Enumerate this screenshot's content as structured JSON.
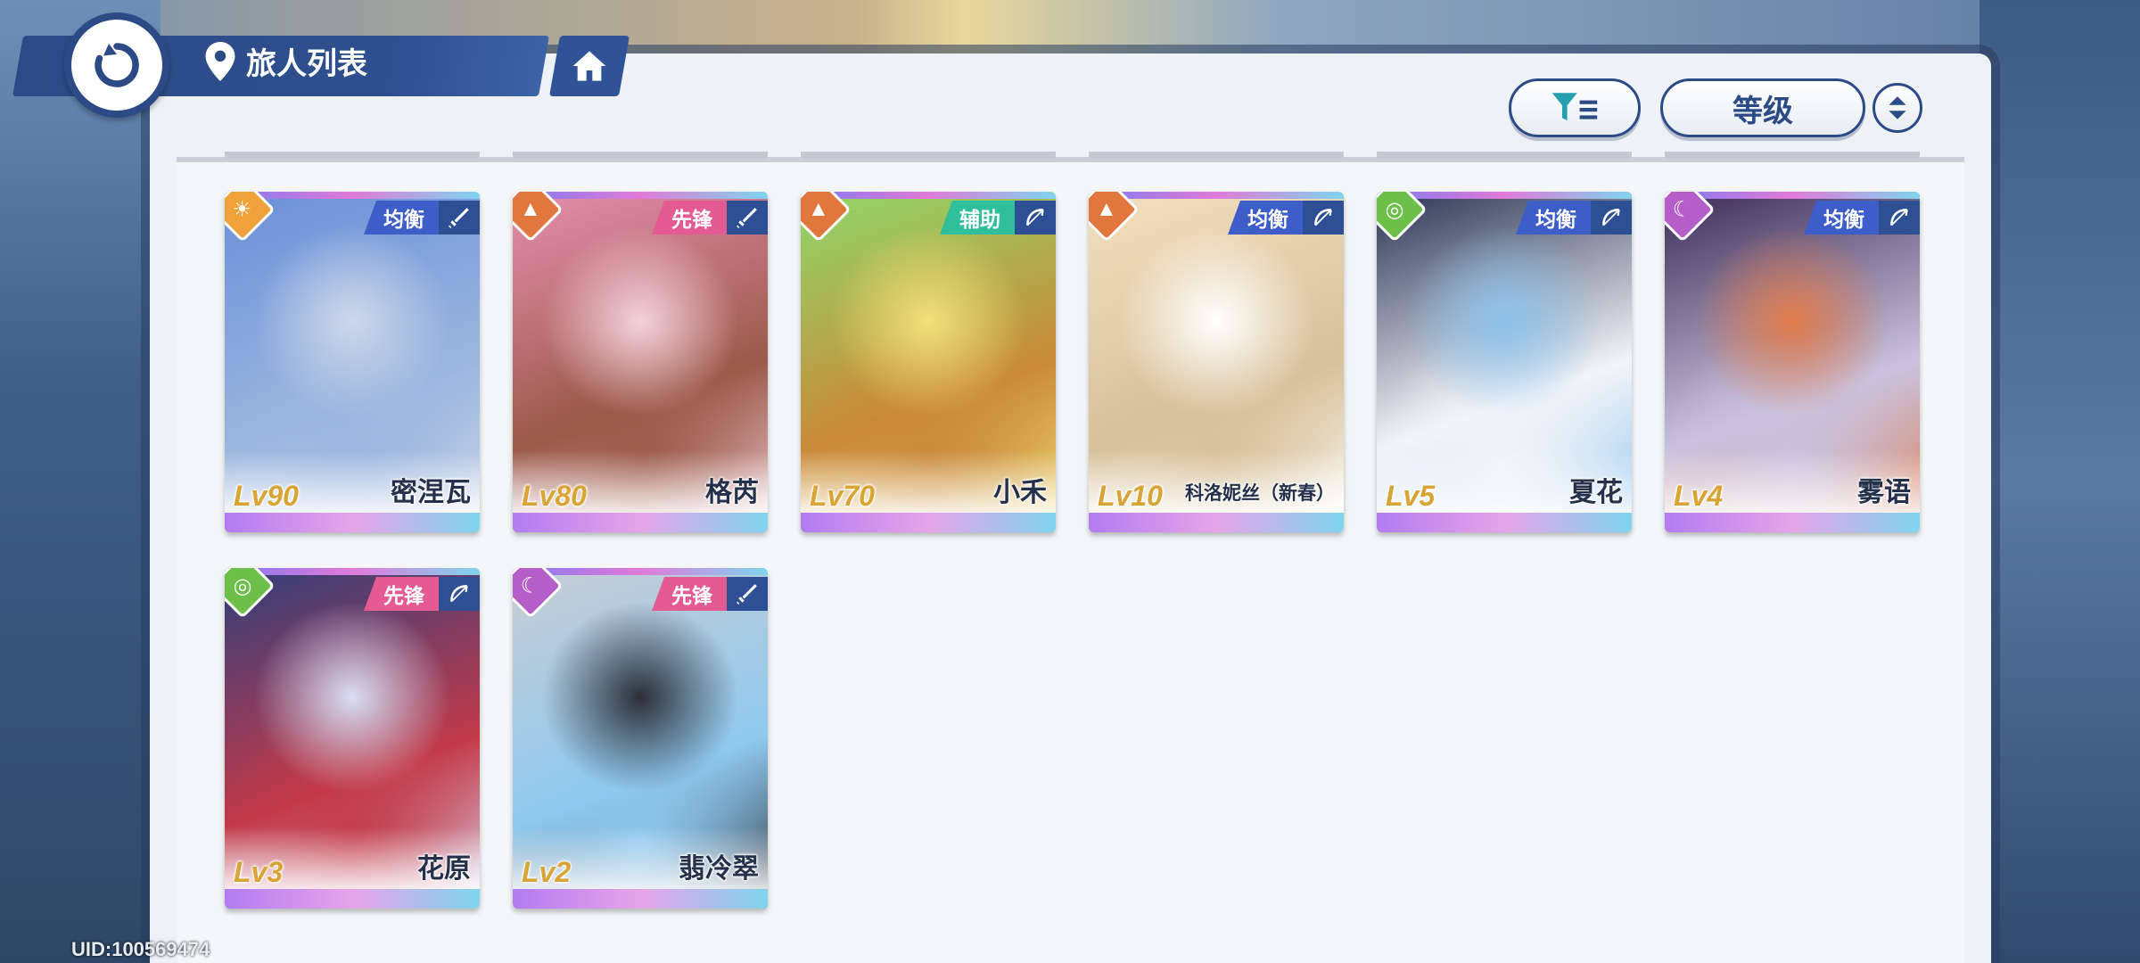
{
  "header": {
    "title": "旅人列表"
  },
  "toolbar": {
    "sort_label": "等级"
  },
  "colors": {
    "primary_dark_blue": "#2c4a86",
    "tag_pink": "#e45b93",
    "tag_blue": "#3d5ec8",
    "tag_green": "#2fbf9a",
    "level_gold": "#d8a535"
  },
  "cards": [
    {
      "level": "Lv90",
      "name": "密涅瓦",
      "role": "均衡",
      "element_icon": "sun-icon",
      "element_color": "#f0a23a",
      "weapon_icon": "sword-icon",
      "art": [
        "#6a8fd8",
        "#cfd8ea",
        "#9bb6de"
      ]
    },
    {
      "level": "Lv80",
      "name": "格芮",
      "role": "先锋",
      "element_icon": "mountain-icon",
      "element_color": "#e0783e",
      "weapon_icon": "sword-icon",
      "art": [
        "#e58fb0",
        "#f4d2dc",
        "#9b5a4a"
      ]
    },
    {
      "level": "Lv70",
      "name": "小禾",
      "role": "辅助",
      "element_icon": "mountain-icon",
      "element_color": "#e0783e",
      "weapon_icon": "bow-icon",
      "art": [
        "#8fd86a",
        "#f2e07a",
        "#c98a3a"
      ]
    },
    {
      "level": "Lv10",
      "name": "科洛妮丝（新春）",
      "role": "均衡",
      "element_icon": "mountain-icon",
      "element_color": "#e0783e",
      "weapon_icon": "bow-icon",
      "art": [
        "#f3e0c0",
        "#ffffff",
        "#d6c19a"
      ]
    },
    {
      "level": "Lv5",
      "name": "夏花",
      "role": "均衡",
      "element_icon": "wind-icon",
      "element_color": "#6cc04a",
      "weapon_icon": "bow-icon",
      "art": [
        "#2a3352",
        "#8ec3ec",
        "#f2f4f8"
      ]
    },
    {
      "level": "Lv4",
      "name": "雾语",
      "role": "均衡",
      "element_icon": "moon-icon",
      "element_color": "#b55ec8",
      "weapon_icon": "bow-icon",
      "art": [
        "#3b2a55",
        "#e07a4a",
        "#c9c3df"
      ]
    },
    {
      "level": "Lv3",
      "name": "花原",
      "role": "先锋",
      "element_icon": "wind-icon",
      "element_color": "#6cc04a",
      "weapon_icon": "bow-icon",
      "art": [
        "#2f3f7a",
        "#d9dff2",
        "#c23a4a"
      ]
    },
    {
      "level": "Lv2",
      "name": "翡冷翠",
      "role": "先锋",
      "element_icon": "moon-icon",
      "element_color": "#b55ec8",
      "weapon_icon": "sword-icon",
      "art": [
        "#c9cdd3",
        "#2b2f38",
        "#8fc9ef"
      ]
    }
  ],
  "footer": {
    "uid": "UID:100569474"
  }
}
